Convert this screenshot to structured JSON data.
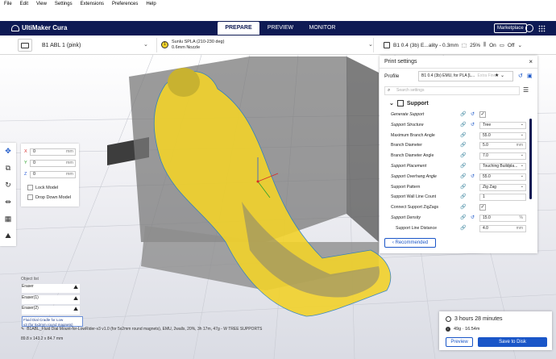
{
  "menu": [
    "File",
    "Edit",
    "View",
    "Settings",
    "Extensions",
    "Preferences",
    "Help"
  ],
  "app": {
    "name": "UltiMaker Cura"
  },
  "stages": [
    {
      "label": "PREPARE",
      "active": true
    },
    {
      "label": "PREVIEW",
      "active": false
    },
    {
      "label": "MONITOR",
      "active": false
    }
  ],
  "header": {
    "marketplace": "Marketplace"
  },
  "toolbar": {
    "printer": "B1 ABL 1 (pink)",
    "material_badge": "1",
    "material_line1": "Sunlu SPLA (210-230 deg)",
    "material_line2": "0.6mm Nozzle",
    "setting_summary": "B1 0.4 (3b) E...ality - 0.3mm",
    "infill": "25%",
    "support": "On",
    "adhesion": "Off"
  },
  "translate": {
    "x_label": "X",
    "x": "0",
    "y_label": "Y",
    "y": "0",
    "z_label": "Z",
    "z": "0",
    "unit": "mm",
    "lock_model": "Lock Model",
    "drop_down_model": "Drop Down Model"
  },
  "object_list": {
    "title": "Object list",
    "items": [
      "Eraser",
      "Eraser(1)",
      "Eraser(2)"
    ],
    "selected_line1": "Fluid Dial Cradle for Low",
    "selected_line2": "v3 (for 5x2mm round magnets)",
    "filename": "B1ABL_Fluid Dial Mount-for-LowRider-v3 v1.0 (for 5x2mm round magnets), EMU, 2walls, 20%, 3h 17m, 47g - W TREE SUPPORTS",
    "dimensions": "89.8 x 143.2 x 84.7 mm"
  },
  "print_settings": {
    "title": "Print settings",
    "close": "×",
    "profile_label": "Profile",
    "profile_value": "B1 0.4 (3b) EMU, for PLA [L...",
    "profile_suffix": "Extra Fine",
    "search_placeholder": "Search settings",
    "section": "Support",
    "rows": [
      {
        "label": "Generate Support",
        "italic": true,
        "type": "check",
        "value": "✓",
        "link": true,
        "reset": true
      },
      {
        "label": "Support Structure",
        "italic": true,
        "type": "select",
        "value": "Tree",
        "link": true,
        "reset": true
      },
      {
        "label": "Maximum Branch Angle",
        "italic": false,
        "type": "select",
        "value": "55.0",
        "link": true,
        "reset": false
      },
      {
        "label": "Branch Diameter",
        "italic": false,
        "type": "input",
        "value": "5.0",
        "unit": "mm",
        "link": true,
        "reset": false
      },
      {
        "label": "Branch Diameter Angle",
        "italic": false,
        "type": "select",
        "value": "7.0",
        "link": true,
        "reset": false
      },
      {
        "label": "Support Placement",
        "italic": true,
        "type": "select",
        "value": "Touching Buildpla...",
        "link": true,
        "reset": false
      },
      {
        "label": "Support Overhang Angle",
        "italic": true,
        "type": "select",
        "value": "55.0",
        "link": true,
        "reset": true
      },
      {
        "label": "Support Pattern",
        "italic": false,
        "type": "select",
        "value": "Zig Zag",
        "link": true,
        "reset": false
      },
      {
        "label": "Support Wall Line Count",
        "italic": false,
        "type": "input",
        "value": "1",
        "link": true,
        "reset": false
      },
      {
        "label": "Connect Support ZigZags",
        "italic": false,
        "type": "check",
        "value": "✓",
        "link": true,
        "reset": false
      },
      {
        "label": "Support Density",
        "italic": true,
        "type": "input",
        "value": "15.0",
        "unit": "%",
        "link": true,
        "reset": true
      },
      {
        "label": "Support Line Distance",
        "italic": false,
        "sub": true,
        "type": "input",
        "value": "4.0",
        "unit": "mm",
        "link": true,
        "reset": false
      }
    ],
    "recommended": "Recommended"
  },
  "action": {
    "time": "3 hours 28 minutes",
    "usage": "49g · 16.54m",
    "preview": "Preview",
    "save": "Save to Disk"
  },
  "colors": {
    "navy": "#0e1a54",
    "accent": "#1a56c8",
    "model_yellow": "#f2d22b",
    "support_grey": "#8a8a8a"
  }
}
